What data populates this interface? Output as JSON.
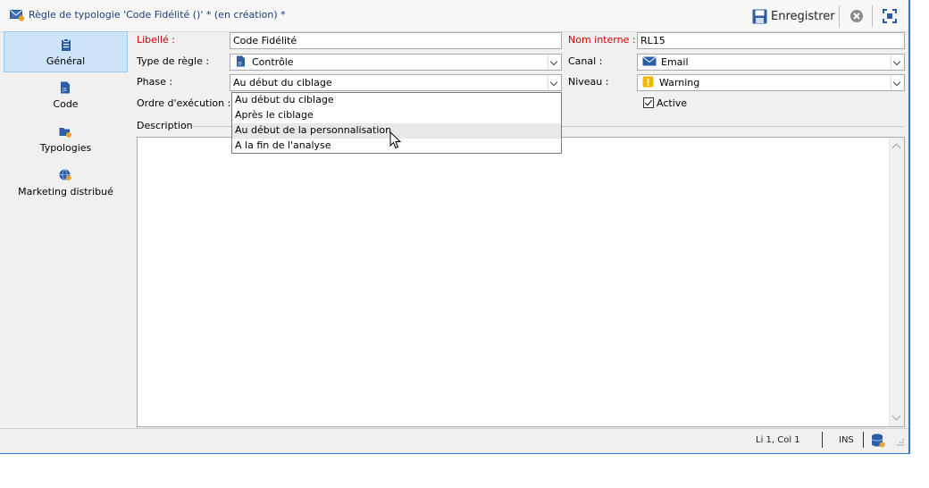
{
  "window": {
    "title": "Règle de typologie 'Code Fidélité ()' * (en création) *",
    "save_label": "Enregistrer",
    "icons": {
      "title": "email-rule-icon",
      "save": "floppy-disk-icon",
      "close": "close-circle-icon",
      "maximize": "maximize-icon"
    }
  },
  "sidebar": {
    "items": [
      {
        "label": "Général",
        "icon": "clipboard-icon",
        "active": true
      },
      {
        "label": "Code",
        "icon": "js-file-icon",
        "active": false
      },
      {
        "label": "Typologies",
        "icon": "folder-typology-icon",
        "active": false
      },
      {
        "label": "Marketing distribué",
        "icon": "globe-user-icon",
        "active": false
      }
    ]
  },
  "form": {
    "libelle": {
      "label": "Libellé :",
      "value": "Code Fidélité"
    },
    "nom_interne": {
      "label": "Nom interne :",
      "value": "RL15"
    },
    "type_regle": {
      "label": "Type de règle :",
      "value": "Contrôle",
      "icon": "js-file-icon"
    },
    "canal": {
      "label": "Canal :",
      "value": "Email",
      "icon": "envelope-icon"
    },
    "phase": {
      "label": "Phase :",
      "value": "Au début du ciblage",
      "options": [
        "Au début du ciblage",
        "Après le ciblage",
        "Au début de la personnalisation",
        "A la fin de l'analyse"
      ],
      "hovered_index": 2
    },
    "niveau": {
      "label": "Niveau :",
      "value": "Warning",
      "icon": "warning-icon"
    },
    "ordre": {
      "label": "Ordre d'exécution :"
    },
    "active": {
      "label": "Active",
      "checked": true
    },
    "description": {
      "label": "Description"
    }
  },
  "status": {
    "position": "Li 1, Col 1",
    "mode": "INS",
    "icon": "database-icon"
  },
  "colors": {
    "accent": "#2b79d0",
    "required_label": "#d00000",
    "sidebar_active": "#cce4f7"
  }
}
